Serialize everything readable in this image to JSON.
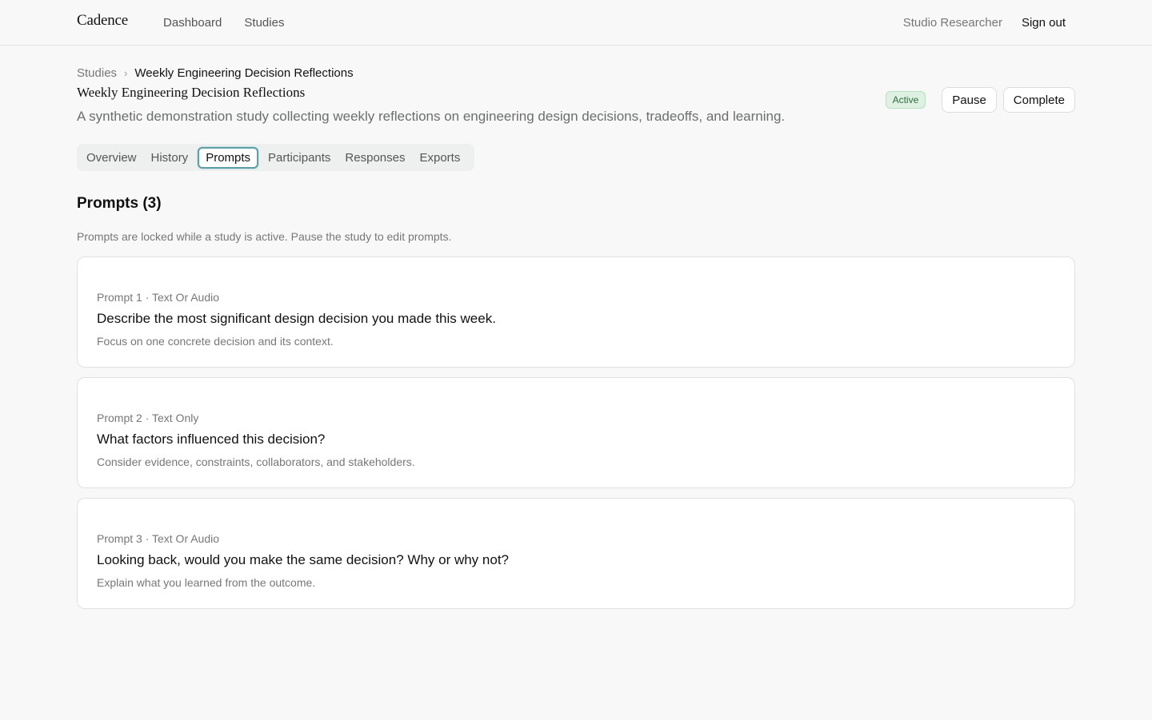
{
  "app": {
    "brand": "Cadence"
  },
  "nav": {
    "dashboard": "Dashboard",
    "studies": "Studies"
  },
  "user": {
    "name": "Studio Researcher",
    "sign_out": "Sign out"
  },
  "breadcrumb": {
    "parent": "Studies",
    "current": "Weekly Engineering Decision Reflections"
  },
  "study": {
    "title": "Weekly Engineering Decision Reflections",
    "description": "A synthetic demonstration study collecting weekly reflections on engineering design decisions, tradeoffs, and learning.",
    "status": "Active",
    "pause_label": "Pause",
    "complete_label": "Complete"
  },
  "tabs": [
    {
      "label": "Overview"
    },
    {
      "label": "History"
    },
    {
      "label": "Prompts"
    },
    {
      "label": "Participants"
    },
    {
      "label": "Responses"
    },
    {
      "label": "Exports"
    }
  ],
  "active_tab": "Prompts",
  "prompts_section": {
    "title": "Prompts (3)",
    "note": "Prompts are locked while a study is active. Pause the study to edit prompts."
  },
  "prompts": [
    {
      "meta": "Prompt 1 · Text Or Audio",
      "question": "Describe the most significant design decision you made this week.",
      "help": "Focus on one concrete decision and its context."
    },
    {
      "meta": "Prompt 2 · Text Only",
      "question": "What factors influenced this decision?",
      "help": "Consider evidence, constraints, collaborators, and stakeholders."
    },
    {
      "meta": "Prompt 3 · Text Or Audio",
      "question": "Looking back, would you make the same decision? Why or why not?",
      "help": "Explain what you learned from the outcome."
    }
  ]
}
